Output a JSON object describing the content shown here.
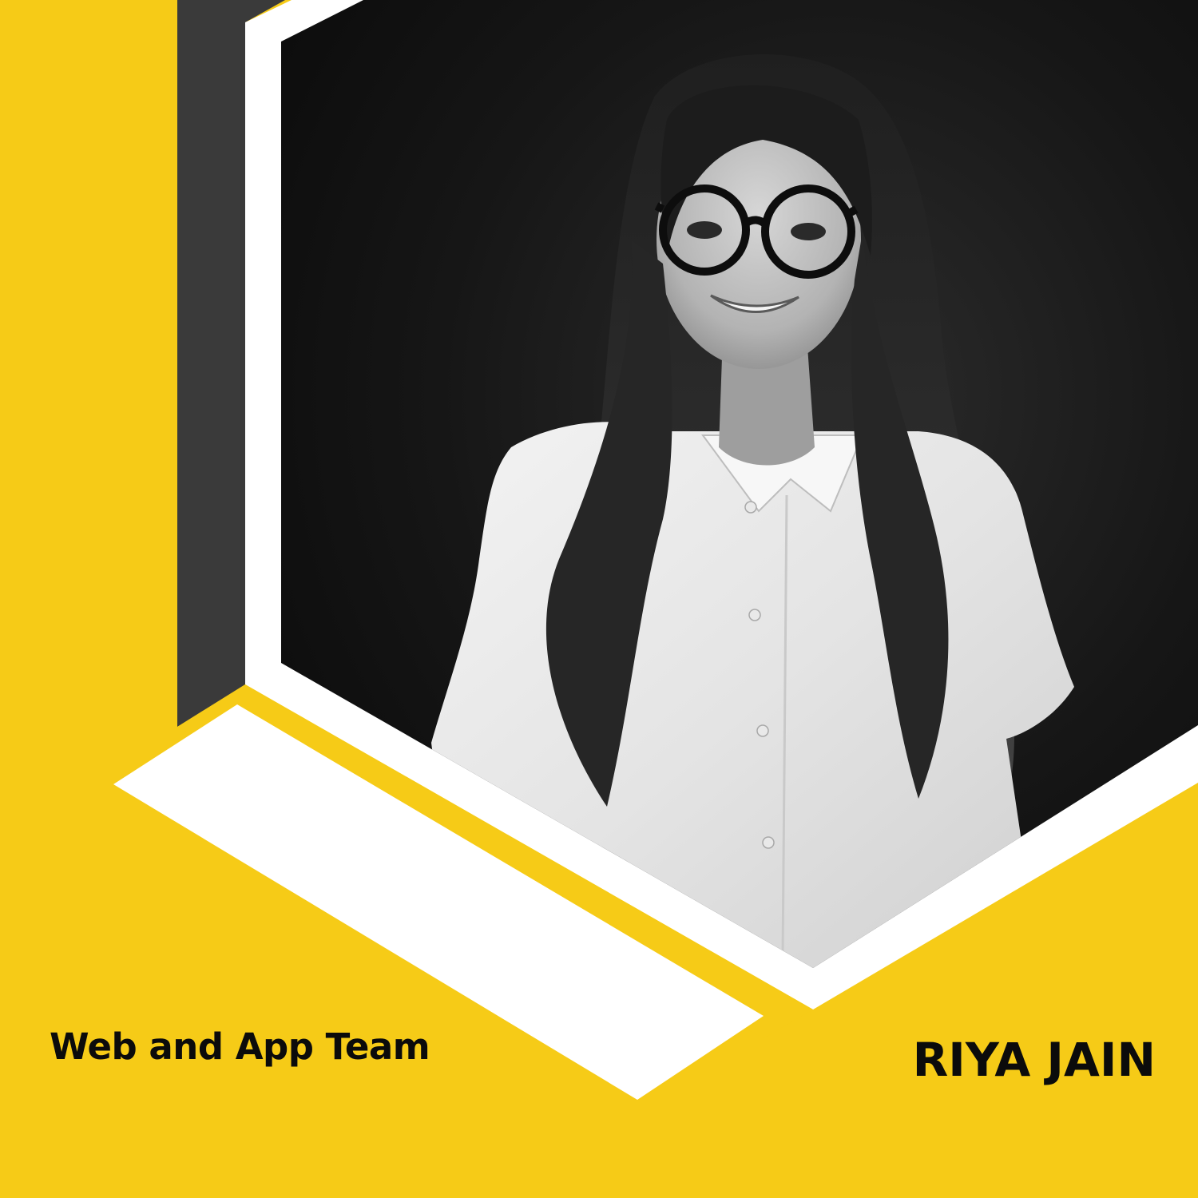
{
  "poster": {
    "team": "Web and App Team",
    "name": "RIYA JAIN"
  },
  "colors": {
    "background": "#F6CB17",
    "accent_white": "#FFFFFF",
    "dark_band": "#3A3A3A",
    "photo_backdrop": "#121212"
  },
  "photo": {
    "subject": "smiling woman with long hair, glasses and white shirt",
    "style": "black-and-white portrait"
  }
}
